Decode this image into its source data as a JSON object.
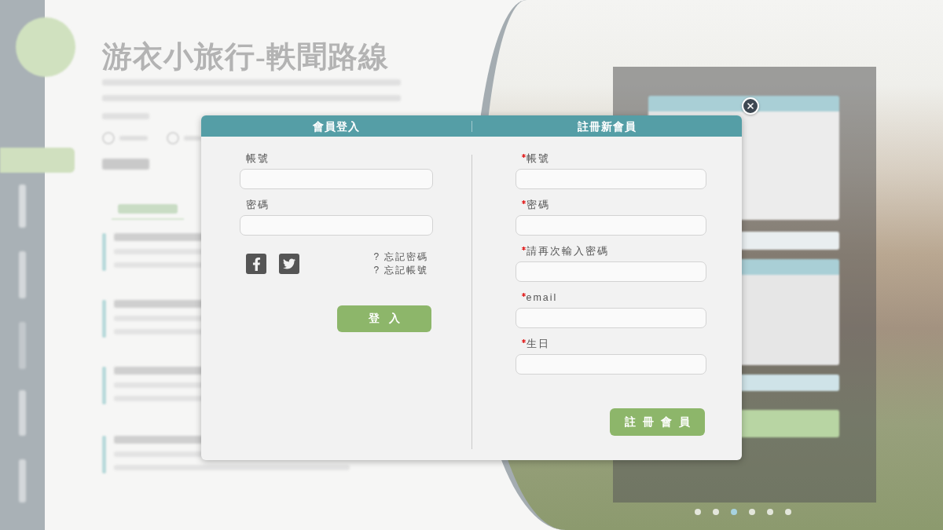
{
  "backdrop": {
    "title": "游衣小旅行-軼聞路線",
    "carousel_dots": [
      {
        "selected": false
      },
      {
        "selected": false
      },
      {
        "selected": true
      },
      {
        "selected": false
      },
      {
        "selected": false
      },
      {
        "selected": false
      }
    ]
  },
  "login": {
    "title": "會員登入",
    "fields": [
      {
        "label": "帳號",
        "required": false
      },
      {
        "label": "密碼",
        "required": false
      }
    ],
    "links": [
      "? 忘記密碼",
      "? 忘記帳號"
    ],
    "button": "登入"
  },
  "register": {
    "title": "註冊新會員",
    "fields": [
      {
        "label": "帳號",
        "required": true
      },
      {
        "label": "密碼",
        "required": true
      },
      {
        "label": "請再次輸入密碼",
        "required": true
      },
      {
        "label": "email",
        "required": true
      },
      {
        "label": "生日",
        "required": true
      }
    ],
    "button": "註冊會員"
  }
}
